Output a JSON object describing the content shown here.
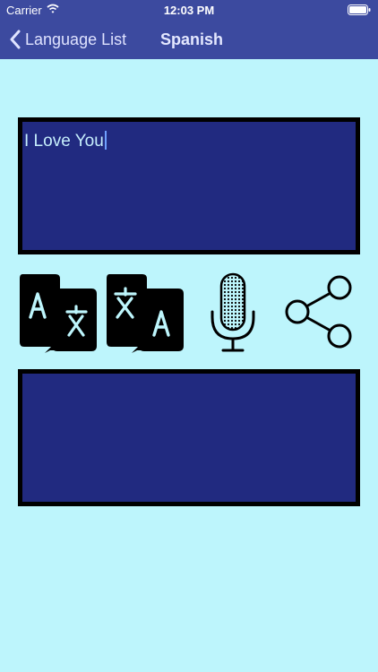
{
  "status_bar": {
    "carrier": "Carrier",
    "time": "12:03 PM",
    "wifi_icon": "wifi-icon",
    "battery_icon": "battery-icon"
  },
  "nav_bar": {
    "back_label": "Language List",
    "back_icon": "chevron-left-icon",
    "title": "Spanish"
  },
  "input": {
    "value": "I Love You"
  },
  "output": {
    "value": ""
  },
  "actions": [
    {
      "name": "translate-forward",
      "icon": "translate-icon"
    },
    {
      "name": "translate-reverse",
      "icon": "translate-reverse-icon"
    },
    {
      "name": "voice",
      "icon": "microphone-icon"
    },
    {
      "name": "share",
      "icon": "share-icon"
    }
  ],
  "colors": {
    "background": "#bdf5fc",
    "nav_bar": "#3c4a9f",
    "text_box": "#212a80",
    "text_box_border": "#000000",
    "input_text": "#c6eefc"
  }
}
